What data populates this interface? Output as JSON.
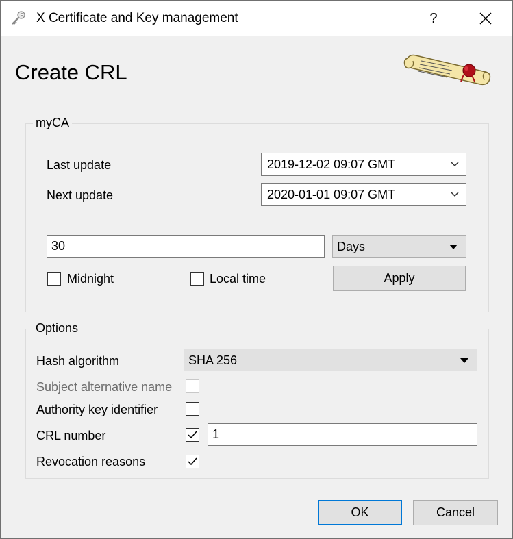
{
  "window": {
    "title": "X Certificate and Key management",
    "help_glyph": "?"
  },
  "header": {
    "title": "Create CRL"
  },
  "ca_group": {
    "legend": "myCA",
    "last_update_label": "Last update",
    "last_update_value": "2019-12-02 09:07 GMT",
    "next_update_label": "Next update",
    "next_update_value": "2020-01-01 09:07 GMT",
    "period_value": "30",
    "period_unit": "Days",
    "midnight_label": "Midnight",
    "midnight_checked": false,
    "local_time_label": "Local time",
    "local_time_checked": false,
    "apply_label": "Apply"
  },
  "options_group": {
    "legend": "Options",
    "hash_algorithm_label": "Hash algorithm",
    "hash_algorithm_value": "SHA 256",
    "subject_alt_name_label": "Subject alternative name",
    "subject_alt_name_checked": false,
    "subject_alt_name_enabled": false,
    "authority_key_id_label": "Authority key identifier",
    "authority_key_id_checked": false,
    "crl_number_label": "CRL number",
    "crl_number_checked": true,
    "crl_number_value": "1",
    "revocation_reasons_label": "Revocation reasons",
    "revocation_reasons_checked": true
  },
  "footer": {
    "ok_label": "OK",
    "cancel_label": "Cancel"
  },
  "colors": {
    "window_bg": "#f0f0f0",
    "titlebar_bg": "#ffffff",
    "default_button_border": "#0078d7",
    "group_border": "#dcdcdc"
  },
  "icons": {
    "app": "certificate-key-icon",
    "help": "help-icon",
    "close": "close-icon",
    "logo": "scroll-seal-icon",
    "dropdown": "chevron-down-icon",
    "check": "checkmark-icon"
  }
}
